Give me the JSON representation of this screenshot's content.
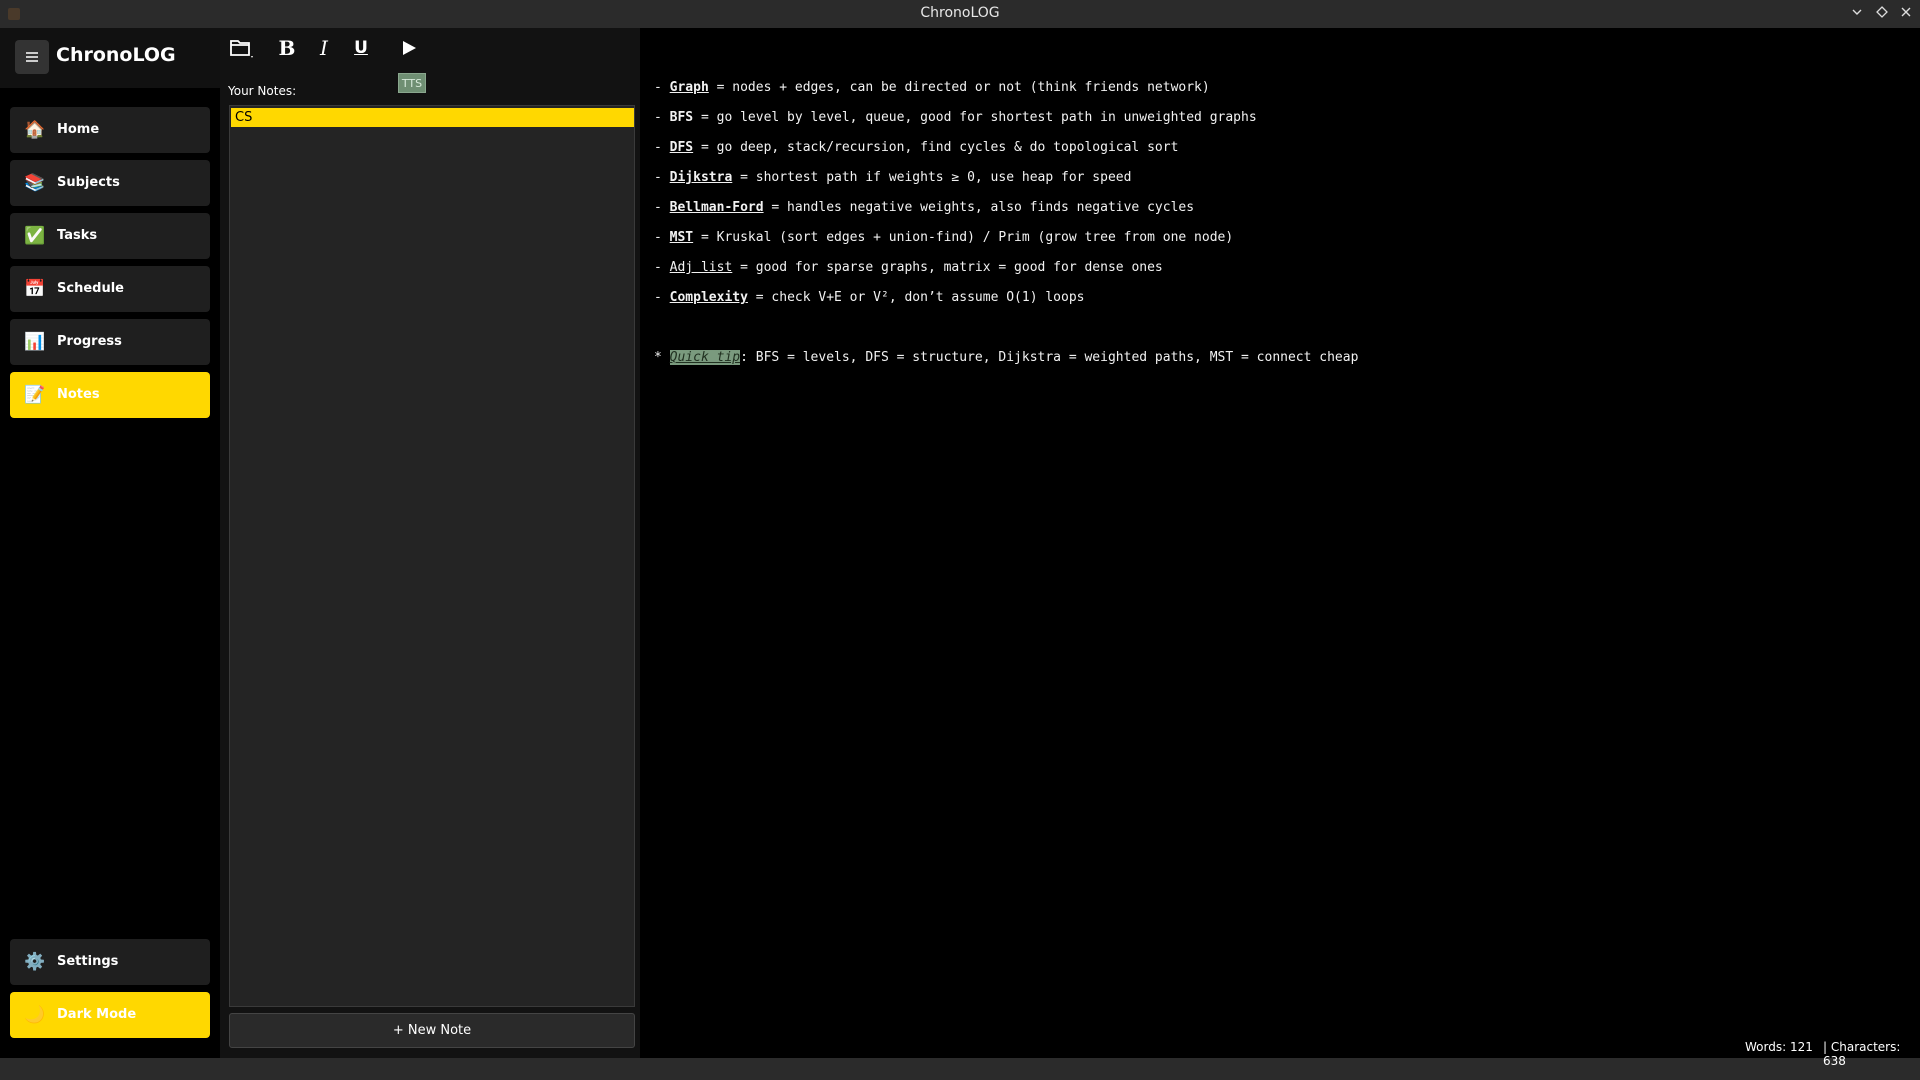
{
  "window": {
    "title": "ChronoLOG",
    "controls": [
      "minimize-icon",
      "restore-icon",
      "close-icon"
    ]
  },
  "sidebar": {
    "brand": "ChronoLOG",
    "menu_icon": "menu-icon",
    "items": [
      {
        "label": "Home",
        "icon": "🏠"
      },
      {
        "label": "Subjects",
        "icon": "📚"
      },
      {
        "label": "Tasks",
        "icon": "✅"
      },
      {
        "label": "Schedule",
        "icon": "📅"
      },
      {
        "label": "Progress",
        "icon": "📊"
      },
      {
        "label": "Notes",
        "icon": "📝",
        "active": true
      }
    ],
    "settings": {
      "label": "Settings",
      "icon": "⚙️"
    },
    "dark_mode": {
      "label": "Dark Mode",
      "icon": "🌙"
    }
  },
  "toolbar": {
    "open_icon": "folder-icon",
    "bold": "B",
    "italic": "I",
    "underline": "U",
    "play_icon": "play-icon",
    "tts_label": "TTS"
  },
  "notes": {
    "heading": "Your Notes:",
    "items": [
      "CS"
    ],
    "new_note": "+ New Note"
  },
  "editor": {
    "lines": [
      {
        "prefix": "- ",
        "term": "Graph",
        "rest": " = nodes + edges, can be directed or not (think friends network)"
      },
      {
        "prefix": "- ",
        "term": "BFS",
        "rest": " = go level by level, queue, good for shortest path in unweighted graphs"
      },
      {
        "prefix": "- ",
        "term": "DFS",
        "rest": " = go deep, stack/recursion, find cycles & do topological sort"
      },
      {
        "prefix": "- ",
        "term": "Dijkstra",
        "rest": " = shortest path if weights ≥ 0, use heap for speed"
      },
      {
        "prefix": "- ",
        "term": "Bellman-Ford",
        "rest": " = handles negative weights, also finds negative cycles"
      },
      {
        "prefix": "- ",
        "term": "MST",
        "rest": " = Kruskal (sort edges + union-find) / Prim (grow tree from one node)"
      },
      {
        "prefix": "- ",
        "term": "Adj list",
        "rest": " = good for sparse graphs, matrix = good for dense ones"
      },
      {
        "prefix": "- ",
        "term": "Complexity",
        "rest": " = check V+E or V², don’t assume O(1) loops"
      }
    ],
    "tip": {
      "prefix": "* ",
      "term": "Quick tip",
      "rest": ": BFS = levels, DFS = structure, Dijkstra = weighted paths, MST = connect cheap"
    }
  },
  "status": {
    "words": "Words: 121",
    "characters": "| Characters: 638"
  }
}
